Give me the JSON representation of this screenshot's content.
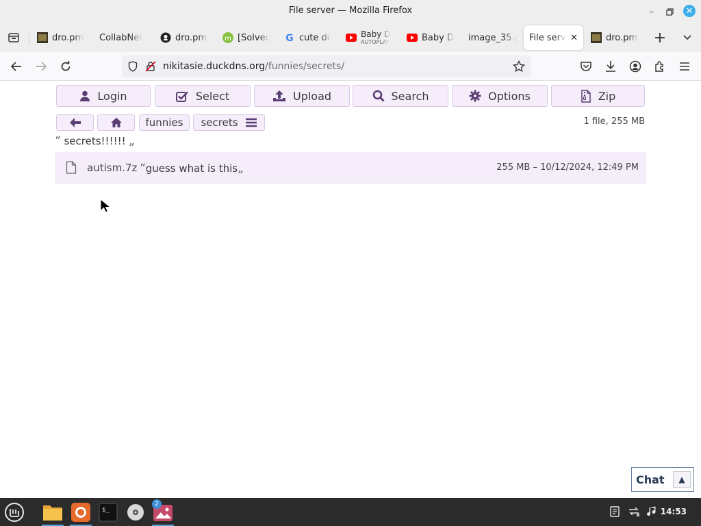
{
  "window": {
    "title": "File server — Mozilla Firefox"
  },
  "tabs": [
    {
      "label": "dro.pmy",
      "icon": "dropbox-favicon",
      "sub": ""
    },
    {
      "label": "CollabNet",
      "icon": "",
      "sub": ""
    },
    {
      "label": "dro.pmy",
      "icon": "github-icon",
      "sub": ""
    },
    {
      "label": "[Solved]",
      "icon": "linuxmint-icon",
      "sub": ""
    },
    {
      "label": "cute do",
      "icon": "google-icon",
      "sub": ""
    },
    {
      "label": "Baby D",
      "icon": "youtube-icon",
      "sub": "AUTOPLAY"
    },
    {
      "label": "Baby De",
      "icon": "youtube-icon",
      "sub": ""
    },
    {
      "label": "image_35.p",
      "icon": "",
      "sub": ""
    },
    {
      "label": "File serv",
      "icon": "",
      "sub": "",
      "active": true
    },
    {
      "label": "dro.pmy",
      "icon": "dropbox-favicon",
      "sub": ""
    }
  ],
  "nav": {
    "url_host": "nikitasie.duckdns.org",
    "url_path": "/funnies/secrets/"
  },
  "toolbar": {
    "login": "Login",
    "select": "Select",
    "upload": "Upload",
    "search": "Search",
    "options": "Options",
    "zip": "Zip"
  },
  "breadcrumb": {
    "items": [
      "funnies",
      "secrets"
    ]
  },
  "summary": "1 file, 255 MB",
  "folder_description": "secrets!!!!!!",
  "files": [
    {
      "name": "autism.7z",
      "description": "guess what is this",
      "meta": "255 MB – 10/12/2024, 12:49 PM"
    }
  ],
  "chat": {
    "label": "Chat"
  },
  "taskbar": {
    "clock": "14:53",
    "badge": "2"
  },
  "colors": {
    "accent_bg": "#f5eefa",
    "accent_border": "#d8c8e4",
    "icon_purple": "#5a3d73"
  }
}
